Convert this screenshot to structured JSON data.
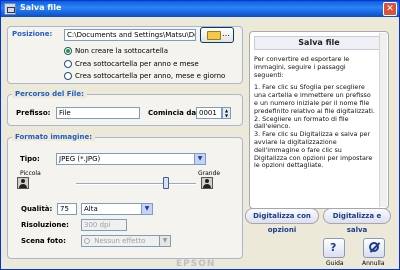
{
  "window": {
    "title": "Salva file"
  },
  "location": {
    "label": "Posizione:",
    "path": "C:\\Documents and Settings\\Matsu\\Doc...",
    "options": [
      {
        "label": "Non creare la sottocartella",
        "selected": true
      },
      {
        "label": "Crea sottocartella per anno e mese",
        "selected": false
      },
      {
        "label": "Crea sottocartella per anno, mese e giorno",
        "selected": false
      }
    ]
  },
  "file_path": {
    "legend": "Percorso del File:",
    "prefix_label": "Prefisso:",
    "prefix_value": "File",
    "start_label": "Comincia da:",
    "start_value": "0001"
  },
  "image_format": {
    "legend": "Formato immagine:",
    "type_label": "Tipo:",
    "type_value": "JPEG (*.JPG)",
    "small_label": "Piccola",
    "large_label": "Grande",
    "slider_level": 0.75,
    "quality_label": "Qualità:",
    "quality_value": "75",
    "quality_level": "Alta",
    "resolution_label": "Risoluzione:",
    "resolution_value": "300 dpi",
    "scene_label": "Scena foto:",
    "scene_value": "Nessun effetto"
  },
  "help": {
    "title": "Salva file",
    "intro": "Per convertire ed esportare le immagini, seguire i passaggi seguenti:",
    "step1": "1. Fare clic su Sfoglia per scegliere una cartella e immettere un prefisso e un numero iniziale per il nome file predefinito relativo ai file digitalizzati.",
    "step2": "2. Scegliere un formato di file dall'elenco.",
    "step3": "3. Fare clic su Digitalizza e salva per avviare la digitalizzazione dell'immagine o fare clic su Digitalizza con opzioni per impostare le opzioni dettagliate."
  },
  "actions": {
    "scan_options": "Digitalizza con opzioni",
    "scan_save": "Digitalizza e salva",
    "guide": "Guida",
    "cancel": "Annulla"
  },
  "brand": "EPSON"
}
